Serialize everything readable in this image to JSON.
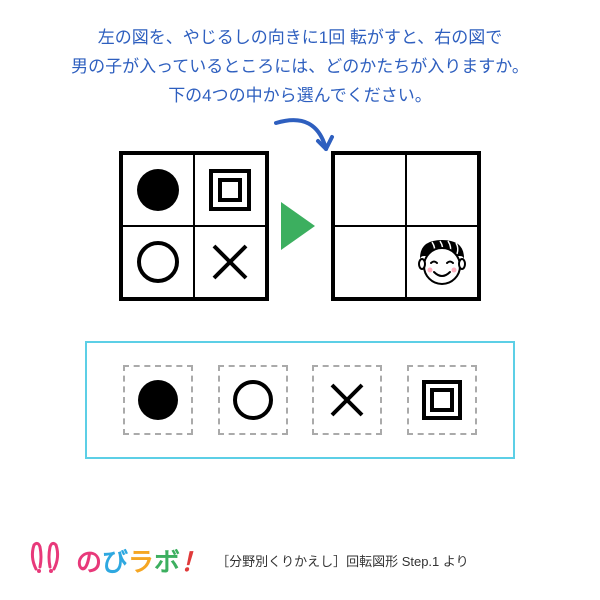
{
  "instruction": {
    "line1": "左の図を、やじるしの向きに1回 転がすと、右の図で",
    "line2": "男の子が入っているところには、どのかたちが入りますか。",
    "line3": "下の4つの中から選んでください。"
  },
  "grid_left": {
    "tl": "filled-circle",
    "tr": "double-square",
    "bl": "circle",
    "br": "cross"
  },
  "grid_right": {
    "tl": "",
    "tr": "",
    "bl": "",
    "br": "boy-face"
  },
  "choices": [
    "filled-circle",
    "circle",
    "cross",
    "double-square"
  ],
  "footer": {
    "brand_no": "の",
    "brand_bi": "び",
    "brand_la": "ラ",
    "brand_bo": "ボ",
    "brand_ex": "！",
    "meta": "［分野別くりかえし］回転図形 Step.1 より"
  }
}
